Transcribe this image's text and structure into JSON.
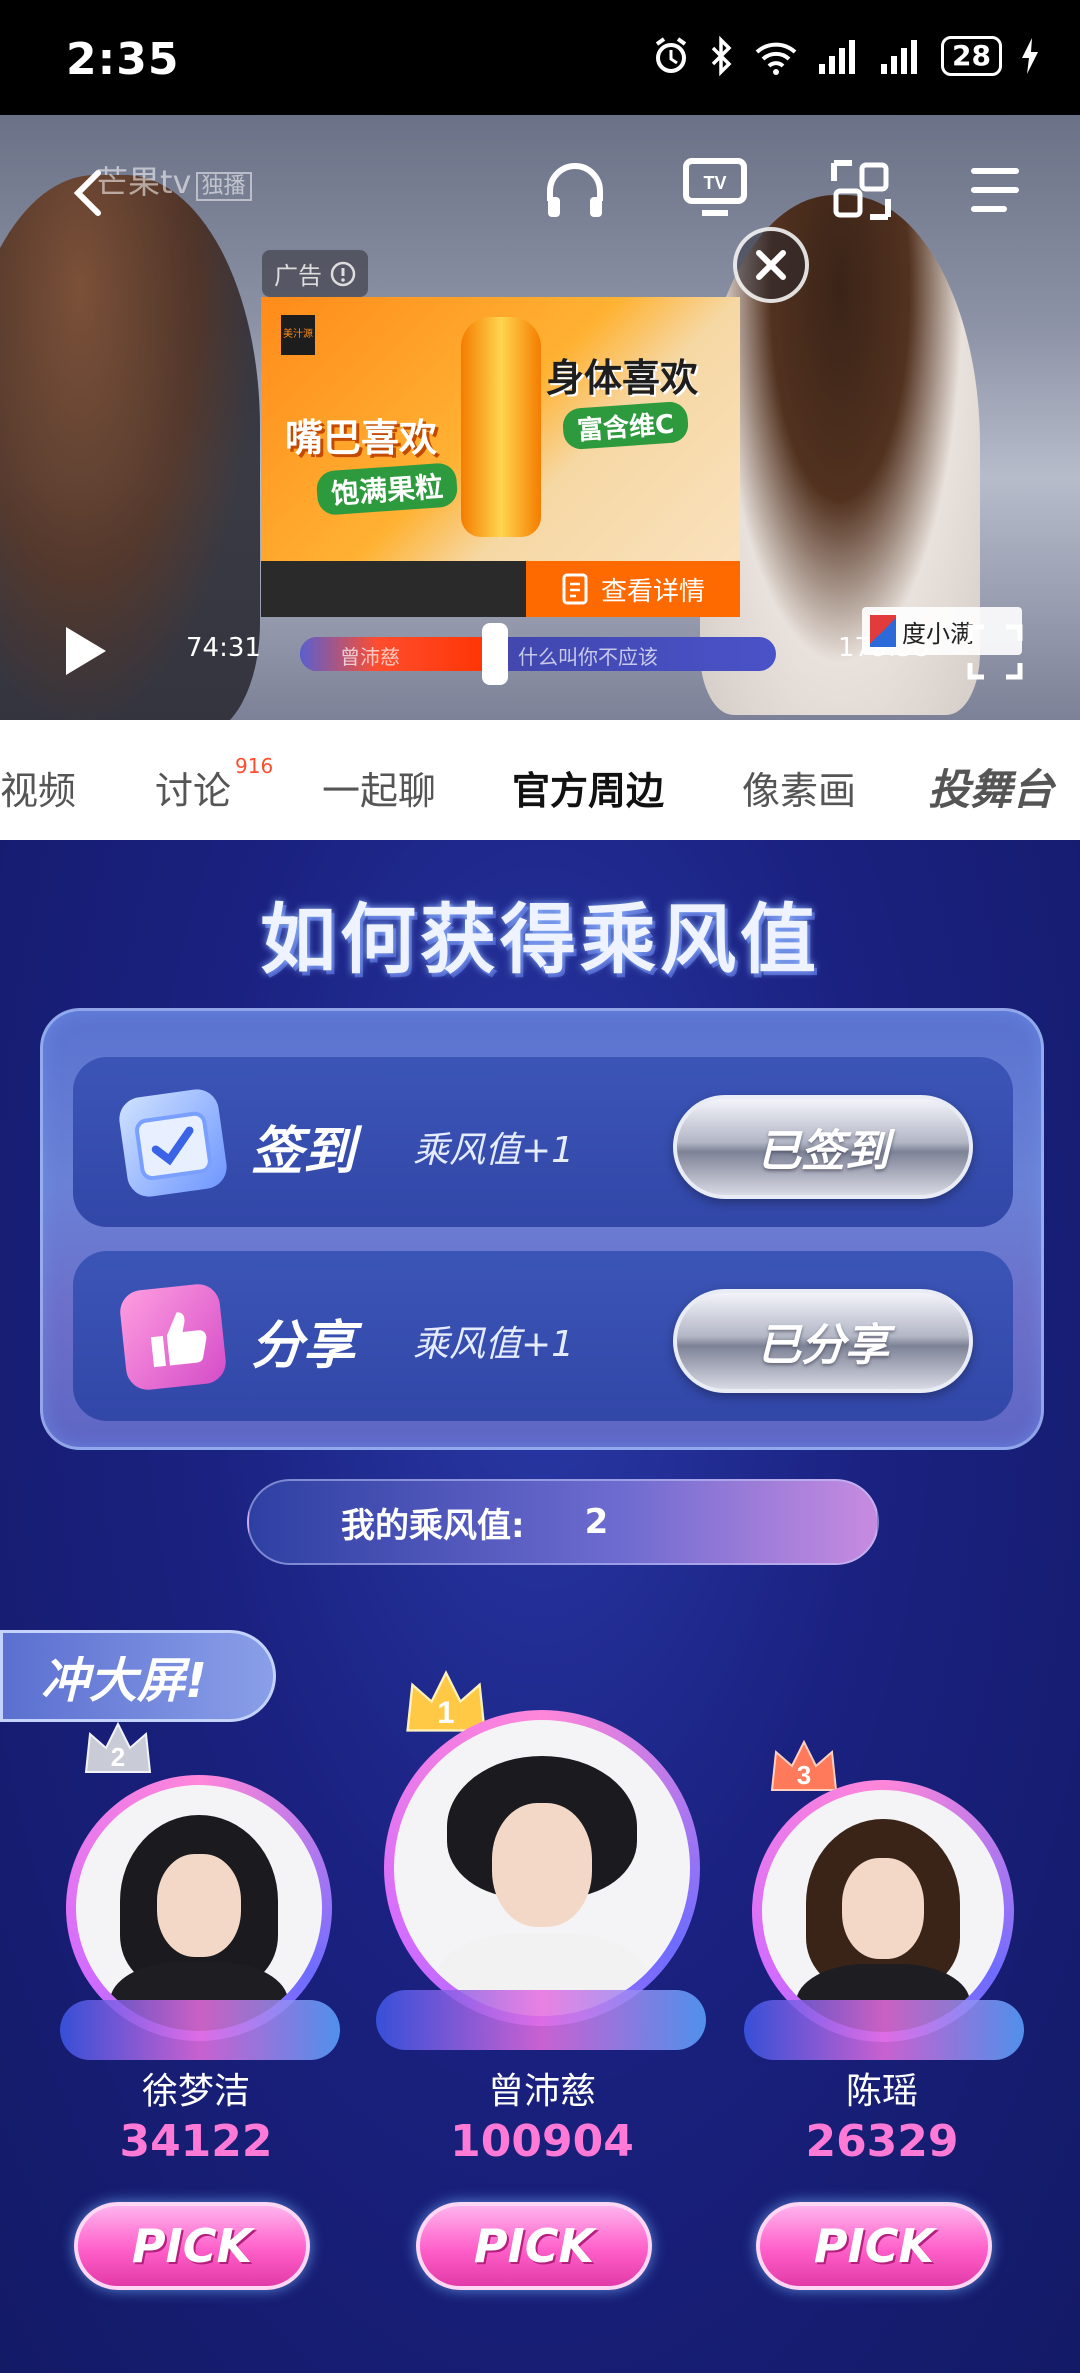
{
  "status_bar": {
    "time": "2:35",
    "battery": "28"
  },
  "player": {
    "logo": "芒果tv",
    "logo_tag": "独播",
    "ad": {
      "label": "广告",
      "headline_left": "嘴巴喜欢",
      "sub_left": "饱满果粒",
      "headline_right": "身体喜欢",
      "sub_right": "富含维C",
      "detail_button": "查看详情",
      "brand_badge": "美汁源"
    },
    "current_time": "74:31",
    "total_time": "179:58",
    "progress_percent": 41,
    "progress_text_1": "曾沛慈",
    "progress_text_2": "什么叫你不应该",
    "corner_ad": "度小满"
  },
  "tabs": [
    {
      "label": "视频"
    },
    {
      "label": "讨论",
      "badge": "916"
    },
    {
      "label": "一起聊"
    },
    {
      "label": "官方周边"
    },
    {
      "label": "像素画"
    },
    {
      "label": "投舞台"
    }
  ],
  "content": {
    "title": "如何获得乘风值",
    "tasks": [
      {
        "label": "签到",
        "reward": "乘风值+1",
        "button": "已签到"
      },
      {
        "label": "分享",
        "reward": "乘风值+1",
        "button": "已分享"
      }
    ],
    "my_value_label": "我的乘风值:",
    "my_value": "2",
    "rush_label": "冲大屏!",
    "ranks": [
      {
        "rank": "2",
        "name": "徐梦洁",
        "score": "34122",
        "pick": "PICK"
      },
      {
        "rank": "1",
        "name": "曾沛慈",
        "score": "100904",
        "pick": "PICK"
      },
      {
        "rank": "3",
        "name": "陈瑶",
        "score": "26329",
        "pick": "PICK"
      }
    ]
  },
  "colors": {
    "accent_pink": "#ff7ad6",
    "background": "#1a1f6e",
    "brand_orange": "#ff6a00"
  }
}
